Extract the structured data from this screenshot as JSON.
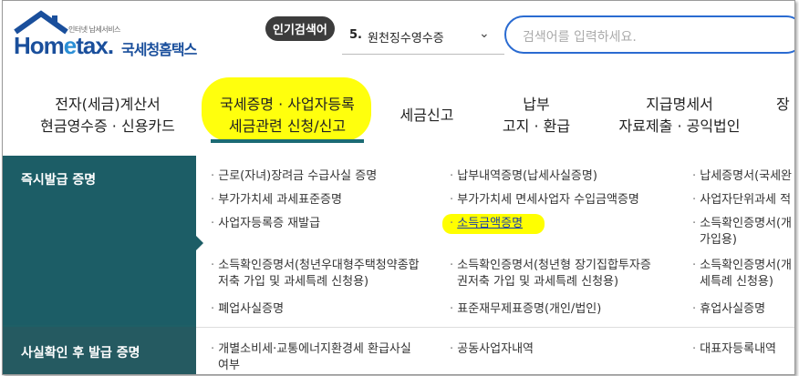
{
  "header": {
    "logo_small": "인터넷 납세서비스",
    "logo_home": "Hom",
    "logo_e": "e",
    "logo_tax": "tax.",
    "logo_korean": "국세청홈택스",
    "popular_label": "인기검색어",
    "popular_rank": "5.",
    "popular_term": "원천징수영수증",
    "search_placeholder": "검색어를 입력하세요."
  },
  "nav": [
    {
      "line1": "전자(세금)계산서",
      "line2": "현금영수증 · 신용카드"
    },
    {
      "line1": "국세증명 · 사업자등록",
      "line2": "세금관련 신청/신고"
    },
    {
      "line1": "세금신고",
      "line2": ""
    },
    {
      "line1": "납부",
      "line2": "고지 · 환급"
    },
    {
      "line1": "지급명세서",
      "line2": "자료제출 · 공익법인"
    },
    {
      "line1": "장",
      "line2": ""
    }
  ],
  "sections": {
    "immediate": "즉시발급 증명",
    "after_check": "사실확인 후 발급 증명"
  },
  "items": {
    "c1r1": "근로(자녀)장려금 수급사실 증명",
    "c1r2": "부가가치세 과세표준증명",
    "c1r3": "사업자등록증 재발급",
    "c1r4a": "소득확인증명서(청년우대형주택청약종합",
    "c1r4b": "저축 가입 및 과세특례 신청용)",
    "c1r5": "폐업사실증명",
    "c2r1": "납부내역증명(납세사실증명)",
    "c2r2": "부가가치세 면세사업자 수입금액증명",
    "c2r3": "소득금액증명",
    "c2r4a": "소득확인증명서(청년형 장기집합투자증",
    "c2r4b": "권저축 가입 및 과세특례 신청용)",
    "c2r5": "표준재무제표증명(개인/법인)",
    "c3r1": "납세증명서(국세완",
    "c3r2": "사업자단위과세 적",
    "c3r3a": "소득확인증명서(개",
    "c3r3b": "가입용)",
    "c3r4a": "소득확인증명서(개",
    "c3r4b": "세특례 신청용)",
    "c3r5": "휴업사실증명",
    "b1a": "개별소비세·교통에너지환경세 환급사실",
    "b1b": "여부",
    "b2": "공동사업자내역",
    "b3": "대표자등록내역"
  },
  "colors": {
    "brand_blue": "#1a4f9c",
    "left_panel": "#1c5d66",
    "search_border": "#2a6bd1",
    "highlight": "#ffff00"
  }
}
